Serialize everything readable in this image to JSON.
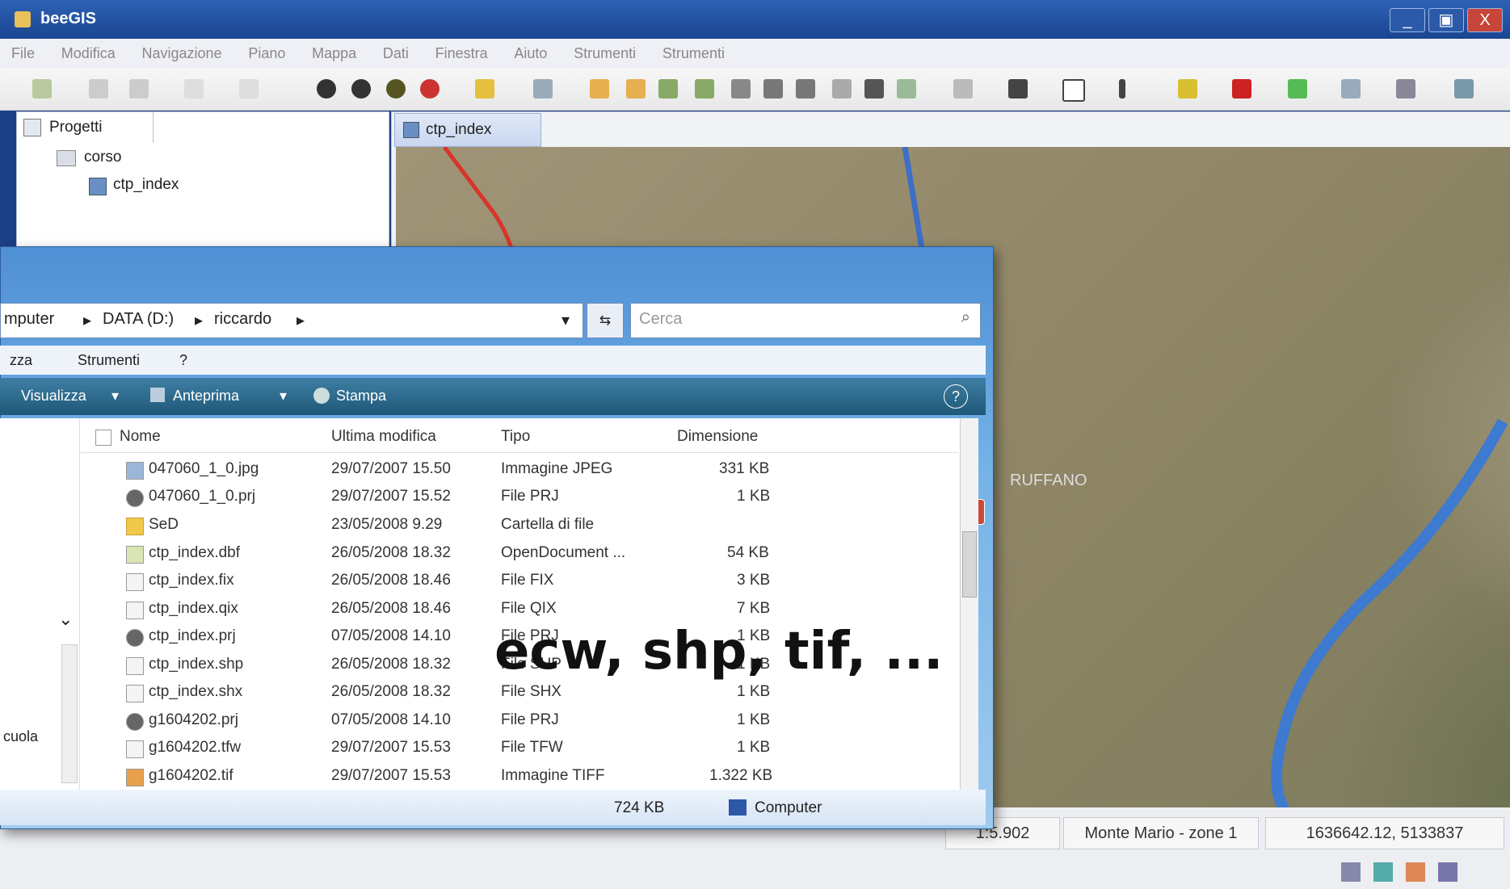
{
  "window": {
    "title": "beeGIS",
    "min": "_",
    "max": "▣",
    "close": "X"
  },
  "menu": [
    "File",
    "Modifica",
    "Navigazione",
    "Piano",
    "Mappa",
    "Dati",
    "Finestra",
    "Aiuto",
    "Strumenti",
    "Strumenti"
  ],
  "projects": {
    "tab_label": "Progetti",
    "tree_root": "corso",
    "tree_child": "ctp_index"
  },
  "map": {
    "tab_label": "ctp_index",
    "place_label": "RUFFANO",
    "crs": "Monte Mario - zone 1",
    "coords": "1636642.12, 5133837",
    "scale": "1:5.902"
  },
  "explorer": {
    "breadcrumb": [
      "mputer",
      "DATA (D:)",
      "riccardo"
    ],
    "search_placeholder": "Cerca",
    "menu": [
      "zza",
      "Strumenti",
      "?"
    ],
    "toolbar": [
      "Visualizza",
      "Anteprima",
      "Stampa"
    ],
    "nav_label": "cuola",
    "columns": [
      "Nome",
      "Ultima modifica",
      "Tipo",
      "Dimensione"
    ],
    "files": [
      {
        "name": "047060_1_0.jpg",
        "date": "29/07/2007 15.50",
        "type": "Immagine JPEG",
        "size": "331 KB"
      },
      {
        "name": "047060_1_0.prj",
        "date": "29/07/2007 15.52",
        "type": "File PRJ",
        "size": "1 KB"
      },
      {
        "name": "SeD",
        "date": "23/05/2008 9.29",
        "type": "Cartella di file",
        "size": ""
      },
      {
        "name": "ctp_index.dbf",
        "date": "26/05/2008 18.32",
        "type": "OpenDocument ...",
        "size": "54 KB"
      },
      {
        "name": "ctp_index.fix",
        "date": "26/05/2008 18.46",
        "type": "File FIX",
        "size": "3 KB"
      },
      {
        "name": "ctp_index.qix",
        "date": "26/05/2008 18.46",
        "type": "File QIX",
        "size": "7 KB"
      },
      {
        "name": "ctp_index.prj",
        "date": "07/05/2008 14.10",
        "type": "File PRJ",
        "size": "1 KB"
      },
      {
        "name": "ctp_index.shp",
        "date": "26/05/2008 18.32",
        "type": "File SHP",
        "size": "1 KB"
      },
      {
        "name": "ctp_index.shx",
        "date": "26/05/2008 18.32",
        "type": "File SHX",
        "size": "1 KB"
      },
      {
        "name": "g1604202.prj",
        "date": "07/05/2008 14.10",
        "type": "File PRJ",
        "size": "1 KB"
      },
      {
        "name": "g1604202.tfw",
        "date": "29/07/2007 15.53",
        "type": "File TFW",
        "size": "1 KB"
      },
      {
        "name": "g1604202.tif",
        "date": "29/07/2007 15.53",
        "type": "Immagine TIFF",
        "size": "1.322 KB"
      }
    ],
    "status_size": "724 KB",
    "status_location": "Computer"
  },
  "overlay_text": "ecw, shp, tif, ..."
}
